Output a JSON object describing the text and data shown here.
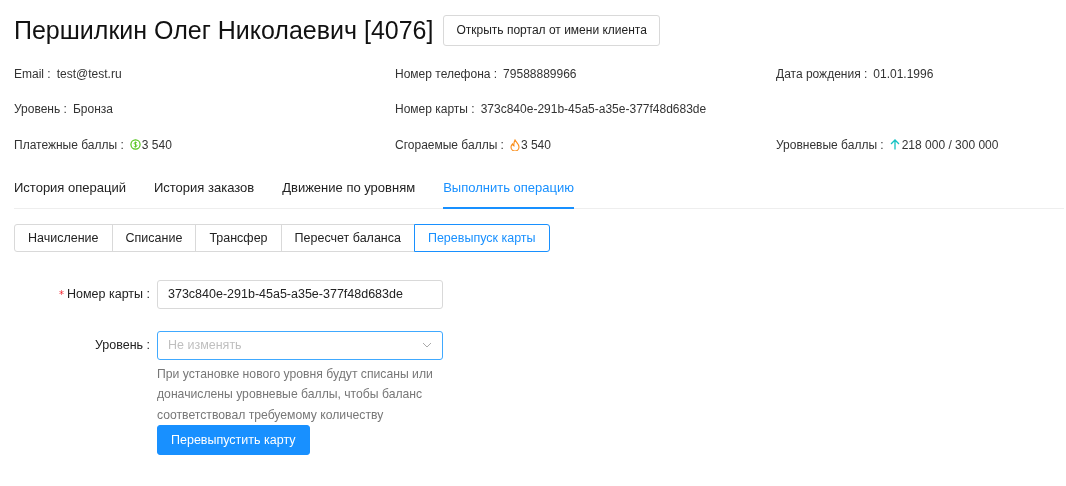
{
  "title": "Першилкин Олег Николаевич [4076]",
  "portal_button": "Открыть портал от имени клиента",
  "info_rows": [
    [
      {
        "label": "Email :",
        "value": "test@test.ru"
      },
      {
        "label": "Номер телефона :",
        "value": "79588889966"
      },
      {
        "label": "Дата рождения :",
        "value": "01.01.1996"
      }
    ],
    [
      {
        "label": "Уровень :",
        "value": "Бронза"
      },
      {
        "label": "Номер карты :",
        "value": "373c840e-291b-45a5-a35e-377f48d683de"
      },
      null
    ],
    [
      {
        "label": "Платежные баллы :",
        "value": "3 540",
        "kind": "coin"
      },
      {
        "label": "Сгораемые баллы :",
        "value": "3 540",
        "kind": "flame"
      },
      {
        "label": "Уровневые баллы :",
        "value": "218 000 / 300 000",
        "kind": "arrow"
      }
    ]
  ],
  "tabs": [
    {
      "label": "История операций",
      "selected": false
    },
    {
      "label": "История заказов",
      "selected": false
    },
    {
      "label": "Движение по уровням",
      "selected": false
    },
    {
      "label": "Выполнить операцию",
      "selected": true
    }
  ],
  "operations": [
    {
      "label": "Начисление",
      "selected": false
    },
    {
      "label": "Списание",
      "selected": false
    },
    {
      "label": "Трансфер",
      "selected": false
    },
    {
      "label": "Пересчет баланса",
      "selected": false
    },
    {
      "label": "Перевыпуск карты",
      "selected": true
    }
  ],
  "form": {
    "card_field": {
      "label": "Номер карты :",
      "required_mark": "*",
      "value": "373c840e-291b-45a5-a35e-377f48d683de"
    },
    "level_field": {
      "label": "Уровень :",
      "placeholder": "Не изменять",
      "focused": true,
      "help": "При установке нового уровня будут списаны или доначислены уровневые баллы, чтобы баланс соответствовал требуемому количеству"
    },
    "submit": "Перевыпустить карту"
  }
}
